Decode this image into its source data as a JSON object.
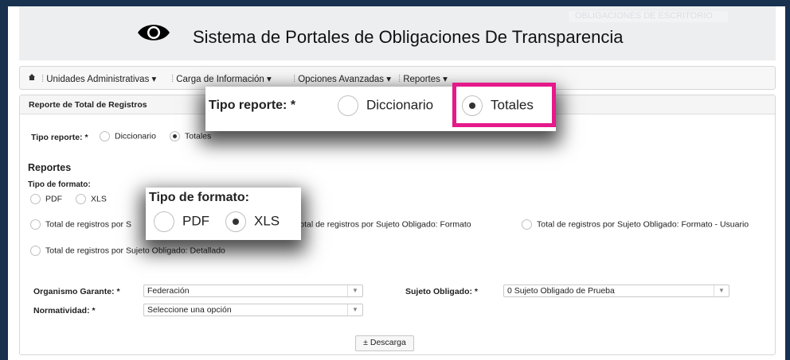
{
  "header": {
    "title": "Sistema de Portales de Obligaciones De Transparencia",
    "ghost_text": "OBLIGACIONES DE ESCRITORIO",
    "icon": "eye-icon"
  },
  "nav": {
    "home_icon": "home-icon",
    "items": [
      {
        "label": "Unidades Administrativas"
      },
      {
        "label": "Carga de Información"
      },
      {
        "label": "Opciones Avanzadas"
      },
      {
        "label": "Reportes"
      }
    ]
  },
  "panel": {
    "title": "Reporte de Total de Registros",
    "tipo_reporte_label": "Tipo reporte: *",
    "tipo_reporte_options": [
      {
        "label": "Diccionario",
        "selected": false
      },
      {
        "label": "Totales",
        "selected": true
      }
    ],
    "reportes_heading": "Reportes",
    "tipo_formato_label": "Tipo de formato:",
    "tipo_formato_options": [
      {
        "label": "PDF",
        "selected": false
      },
      {
        "label": "XLS",
        "selected": true
      }
    ],
    "report_options": [
      {
        "label": "Total de registros por S"
      },
      {
        "label": "Total de registros por Sujeto Obligado: Formato"
      },
      {
        "label": "Total de registros por Sujeto Obligado: Formato - Usuario"
      },
      {
        "label": "Total de registros por Sujeto Obligado: Detallado"
      }
    ],
    "organismo_label": "Organismo Garante: *",
    "organismo_value": "Federación",
    "sujeto_label": "Sujeto Obligado: *",
    "sujeto_value": "0 Sujeto Obligado de Prueba",
    "normatividad_label": "Normatividad: *",
    "normatividad_value": "Seleccione una opción",
    "download_label": "Descarga"
  },
  "zoom_reporte": {
    "label": "Tipo reporte: *",
    "options": [
      {
        "label": "Diccionario",
        "selected": false
      },
      {
        "label": "Totales",
        "selected": true
      }
    ],
    "highlight_color": "#e5198a"
  },
  "zoom_formato": {
    "label": "Tipo de formato:",
    "options": [
      {
        "label": "PDF",
        "selected": false
      },
      {
        "label": "XLS",
        "selected": true
      }
    ]
  }
}
